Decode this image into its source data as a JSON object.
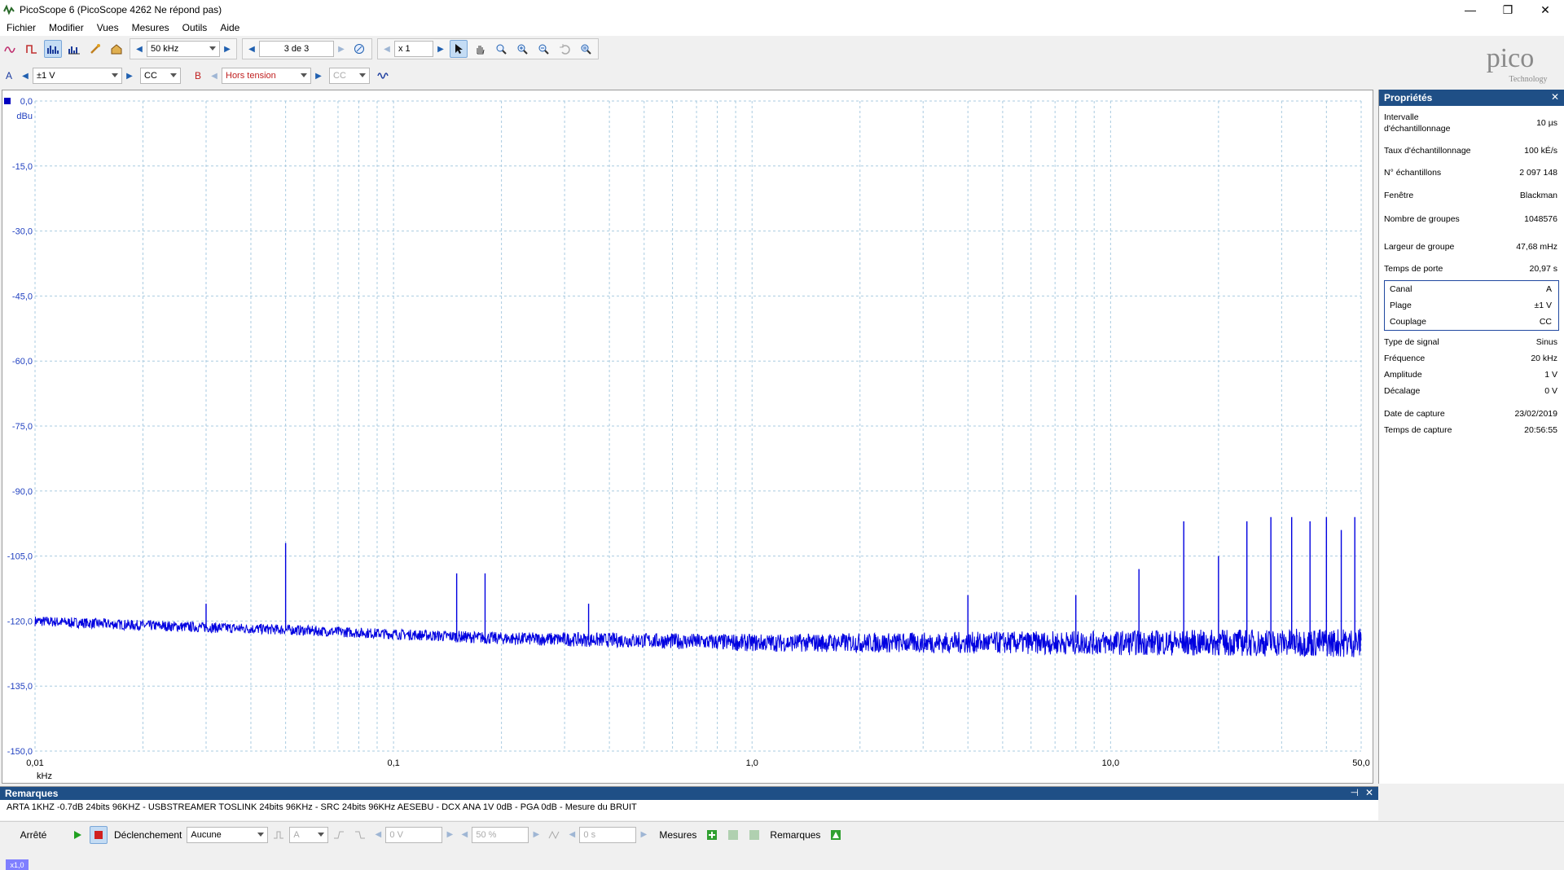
{
  "window": {
    "title": "PicoScope 6 (PicoScope 4262 Ne répond pas)"
  },
  "menu": [
    "Fichier",
    "Modifier",
    "Vues",
    "Mesures",
    "Outils",
    "Aide"
  ],
  "toolbar1": {
    "frequency": "50 kHz",
    "buffer": "3 de 3",
    "zoom": "x 1"
  },
  "toolbar2": {
    "channel_a_label": "A",
    "channel_a_range": "±1 V",
    "channel_a_coupling": "CC",
    "channel_b_label": "B",
    "channel_b_range": "Hors tension",
    "channel_b_coupling": "CC"
  },
  "logo": {
    "name": "pico",
    "sub": "Technology"
  },
  "plot": {
    "y_unit": "dBu",
    "x_unit": "kHz",
    "x_badge": "x1,0",
    "y_ticks": [
      "0,0",
      "-15,0",
      "-30,0",
      "-45,0",
      "-60,0",
      "-75,0",
      "-90,0",
      "-105,0",
      "-120,0",
      "-135,0",
      "-150,0"
    ],
    "x_ticks": [
      "0,01",
      "0,1",
      "1,0",
      "10,0",
      "50,0"
    ],
    "trace_color": "#0000e0"
  },
  "chart_data": {
    "type": "line",
    "xlabel": "kHz",
    "ylabel": "dBu",
    "x_scale": "log",
    "xlim": [
      0.01,
      50
    ],
    "ylim": [
      -150,
      0
    ],
    "grid": true,
    "noise_floor": {
      "x": [
        0.01,
        0.02,
        0.05,
        0.1,
        0.2,
        0.5,
        1,
        2,
        5,
        10,
        20,
        50
      ],
      "y": [
        -120,
        -121,
        -122,
        -123,
        -124,
        -124.5,
        -125,
        -125,
        -125,
        -125,
        -125,
        -125
      ]
    },
    "peaks": {
      "x": [
        0.03,
        0.05,
        0.15,
        0.18,
        0.35,
        4.0,
        8.0,
        12.0,
        16.0,
        20.0,
        24.0,
        28.0,
        32.0,
        36.0,
        40.0,
        44.0,
        48.0
      ],
      "y": [
        -116,
        -102,
        -109,
        -109,
        -116,
        -114,
        -114,
        -108,
        -97,
        -105,
        -97,
        -96,
        -96,
        -97,
        -96,
        -99,
        -96
      ]
    }
  },
  "properties": {
    "title": "Propriétés",
    "rows": [
      {
        "k": "Intervalle d'échantillonnage",
        "v": "10 µs"
      },
      {
        "k": "Taux d'échantillonnage",
        "v": "100 kÉ/s"
      },
      {
        "k": "N° échantillons",
        "v": "2 097 148"
      },
      {
        "k": "Fenêtre",
        "v": "Blackman"
      },
      {
        "k": "Nombre de groupes",
        "v": "1048576"
      },
      {
        "k": "Largeur de groupe",
        "v": "47,68 mHz"
      },
      {
        "k": "Temps de porte",
        "v": "20,97 s"
      }
    ],
    "channel": [
      {
        "k": "Canal",
        "v": "A"
      },
      {
        "k": "Plage",
        "v": "±1 V"
      },
      {
        "k": "Couplage",
        "v": "CC"
      }
    ],
    "signal": [
      {
        "k": "Type de signal",
        "v": "Sinus"
      },
      {
        "k": "Fréquence",
        "v": "20 kHz"
      },
      {
        "k": "Amplitude",
        "v": "1 V"
      },
      {
        "k": "Décalage",
        "v": "0 V"
      }
    ],
    "capture": [
      {
        "k": "Date de capture",
        "v": "23/02/2019"
      },
      {
        "k": "Temps de capture",
        "v": "20:56:55"
      }
    ]
  },
  "remarks": {
    "title": "Remarques",
    "text": "ARTA 1KHZ -0.7dB 24bits 96KHZ - USBSTREAMER TOSLINK 24bits 96KHz - SRC 24bits 96KHz AESEBU - DCX ANA 1V 0dB - PGA 0dB - Mesure du BRUIT",
    "pin": "⊣",
    "close": "✕"
  },
  "status": {
    "state": "Arrêté",
    "trigger_label": "Déclenchement",
    "trigger_mode": "Aucune",
    "trigger_channel": "A",
    "trigger_level": "0 V",
    "trigger_pos": "50 %",
    "trigger_delay": "0 s",
    "measures_label": "Mesures",
    "remarks_label": "Remarques"
  }
}
